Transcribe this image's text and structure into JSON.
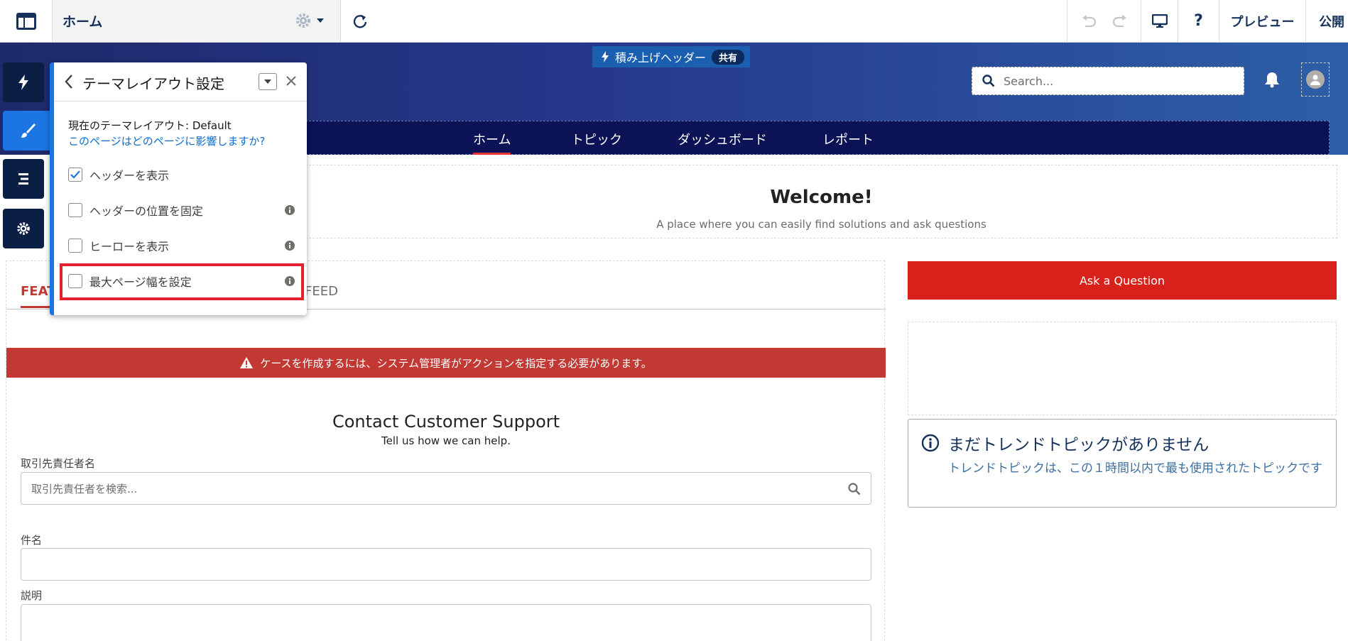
{
  "builder": {
    "page_name": "ホーム",
    "help": "?",
    "preview": "プレビュー",
    "publish": "公開"
  },
  "site": {
    "stacked_header": "積み上げヘッダー",
    "shared_badge": "共有",
    "search_placeholder": "Search...",
    "nav": [
      "ホーム",
      "トピック",
      "ダッシュボード",
      "レポート"
    ],
    "welcome_title": "Welcome!",
    "welcome_subtitle": "A place where you can easily find solutions and ask questions"
  },
  "main": {
    "tab_featured": "FEAT",
    "tab_feed": "FEED",
    "alert": "ケースを作成するには、システム管理者がアクションを指定する必要があります。",
    "form_title": "Contact Customer Support",
    "form_subtitle": "Tell us how we can help.",
    "contact_label": "取引先責任者名",
    "contact_placeholder": "取引先責任者を検索...",
    "subject_label": "件名",
    "description_label": "説明"
  },
  "sidebar_right": {
    "ask_button": "Ask a Question",
    "trend_title": "まだトレンドトピックがありません",
    "trend_desc": "トレンドトピックは、この１時間以内で最も使用されたトピックです"
  },
  "panel": {
    "title": "テーマレイアウト設定",
    "current_layout": "現在のテーマレイアウト: Default",
    "affect_link": "このページはどのページに影響しますか?",
    "options": [
      {
        "label": "ヘッダーを表示",
        "checked": true
      },
      {
        "label": "ヘッダーの位置を固定",
        "checked": false
      },
      {
        "label": "ヒーローを表示",
        "checked": false
      },
      {
        "label": "最大ページ幅を設定",
        "checked": false
      }
    ]
  },
  "colors": {
    "accent_blue": "#1b76e4",
    "alert_red": "#c23934",
    "ask_red": "#d8211b",
    "highlight_red": "#e3202e",
    "nav_navy": "#0b1256"
  }
}
